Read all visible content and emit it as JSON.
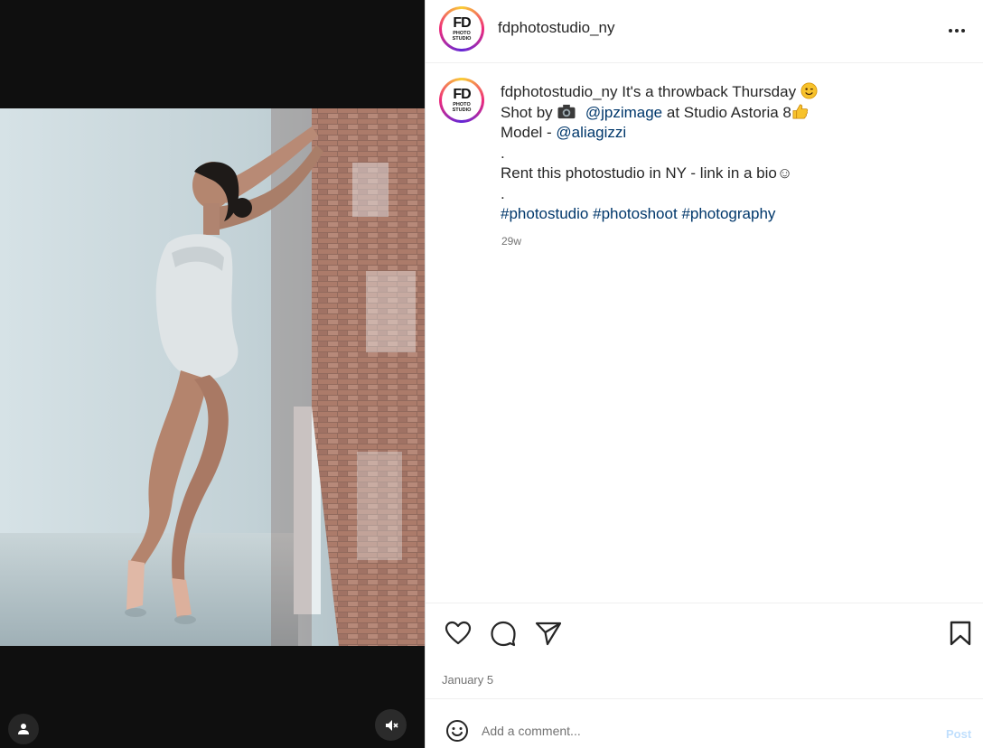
{
  "post": {
    "username": "fdphotostudio_ny",
    "avatar_logo": {
      "main": "FD",
      "sub": "PHOTO STUDIO"
    },
    "more_icon": "more-horizontal-icon"
  },
  "caption": {
    "username": "fdphotostudio_ny",
    "line1_text": "It's a throwback Thursday",
    "line2_prefix": "Shot by",
    "line2_mention": "@jpzimage",
    "line2_suffix": "at Studio Astoria 8",
    "line3_prefix": "Model -",
    "line3_mention": "@aliagizzi",
    "dot1": ".",
    "line5_text": "Rent this photostudio in NY - link in a bio",
    "line5_emoji": "☺",
    "dot2": ".",
    "hashtags": [
      "#photostudio",
      "#photoshoot",
      "#photography"
    ],
    "timestamp": "29w"
  },
  "actions": {
    "like_icon": "heart-icon",
    "comment_icon": "comment-icon",
    "share_icon": "paper-plane-icon",
    "save_icon": "bookmark-icon",
    "date": "January 5"
  },
  "comment_bar": {
    "emoji_icon": "emoji-smile-icon",
    "placeholder": "Add a comment...",
    "post_label": "Post",
    "post_color": "#c0dffd"
  },
  "media": {
    "user_tag_icon": "user-tag-icon",
    "mute_icon": "speaker-muted-icon"
  },
  "colors": {
    "link": "#00376b",
    "text": "#262626",
    "muted": "#737373",
    "media_bg": "#0f0f0f"
  }
}
